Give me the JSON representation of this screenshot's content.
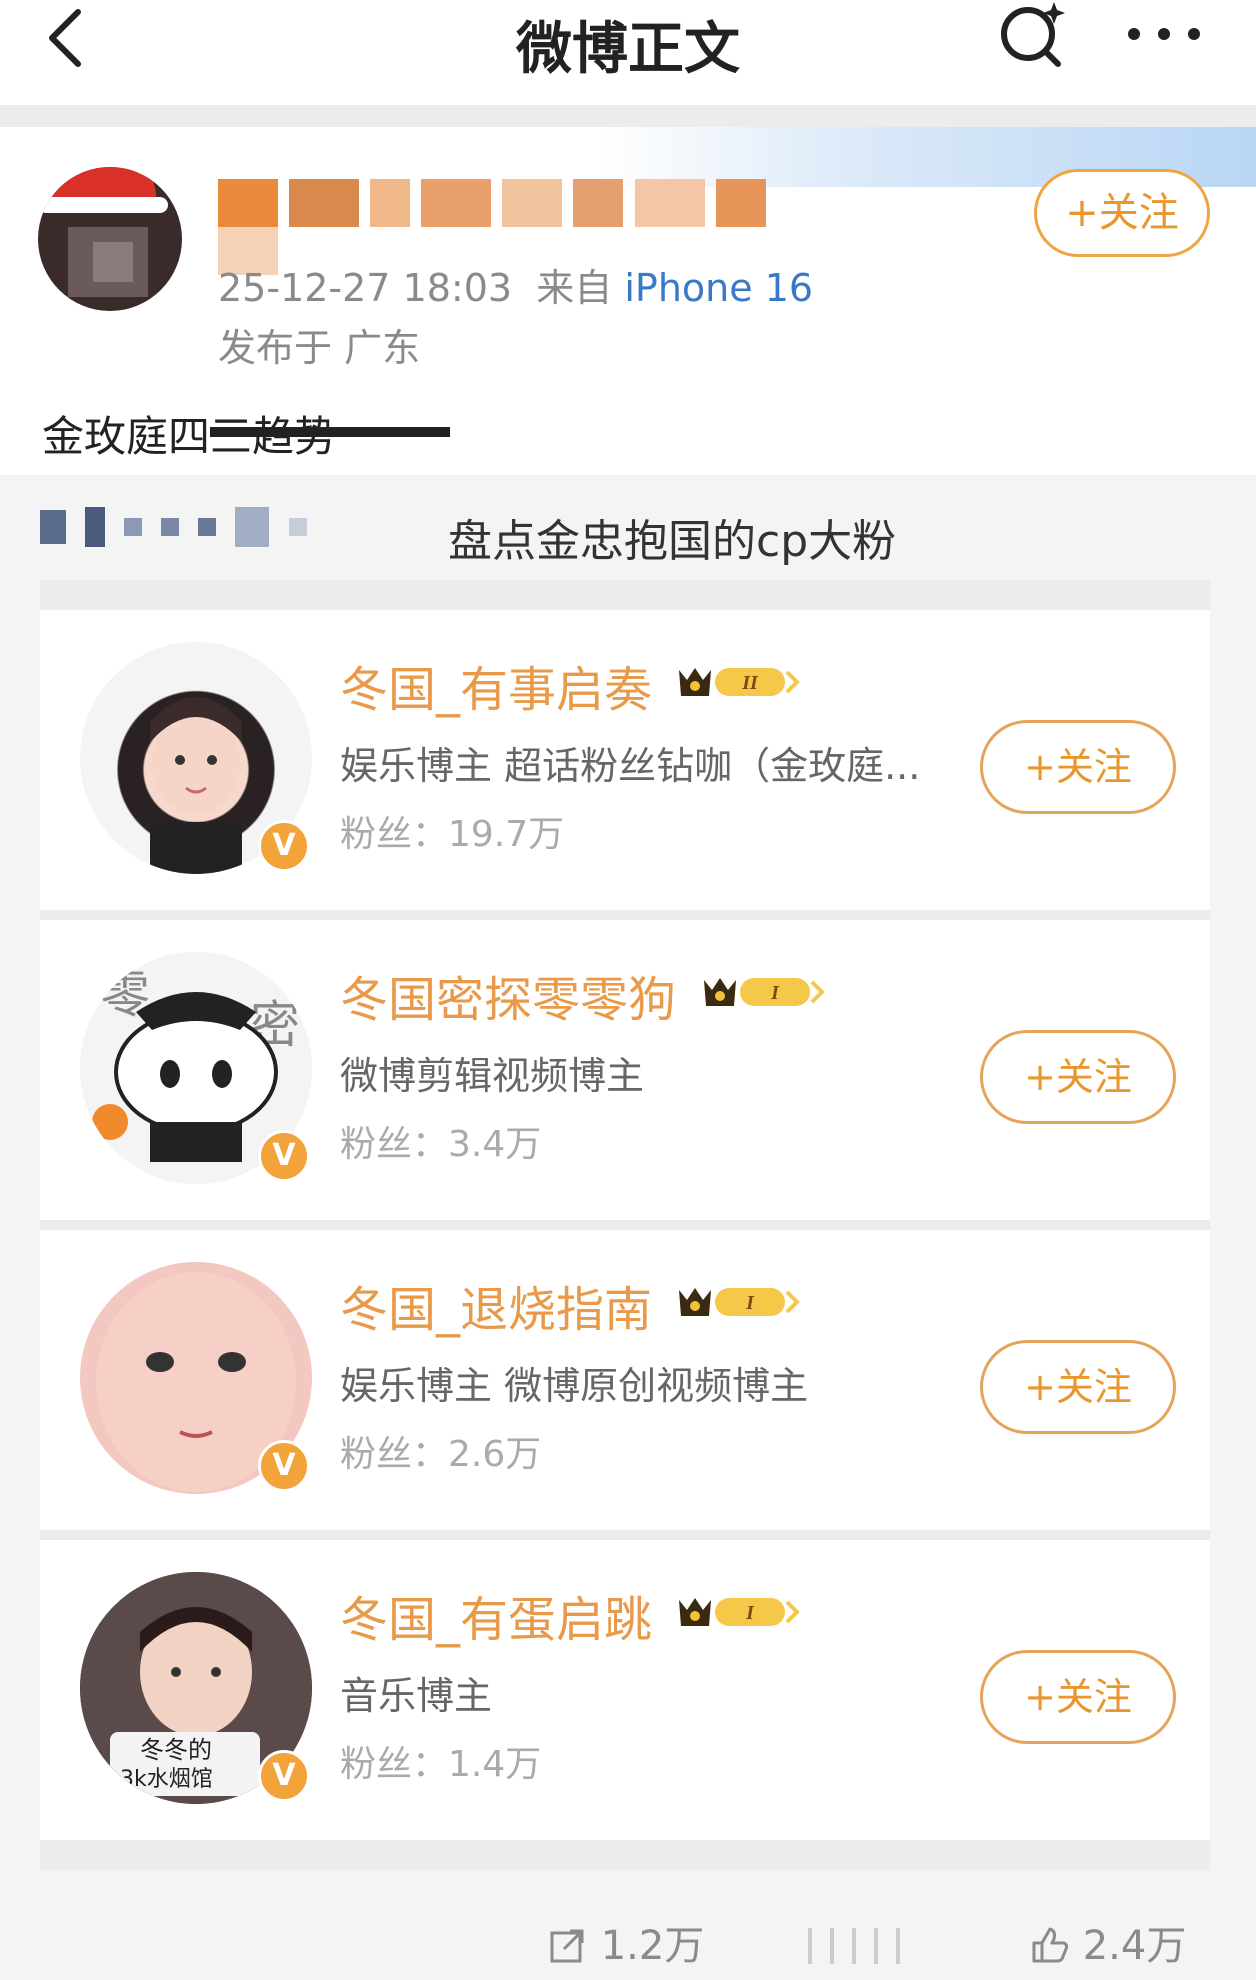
{
  "header": {
    "title": "微博正文",
    "back_icon": "chevron-left-icon",
    "search_icon": "search-sparkle-icon",
    "more_icon": "more-dots-icon"
  },
  "post": {
    "author_name_obscured": true,
    "time": "25-12-27 18:03",
    "from_label": "来自",
    "device": "iPhone 16",
    "location": "发布于 广东",
    "follow_label": "+关注",
    "text": "金玫庭四三趋势"
  },
  "repost": {
    "title": "盘点金忠抱国的cp大粉",
    "cards": [
      {
        "name": "冬国_有事启奏",
        "level": "II",
        "desc": "娱乐博主 超话粉丝钻咖（金玫庭...",
        "fans": "粉丝：19.7万",
        "follow_label": "+关注",
        "verified_label": "V"
      },
      {
        "name": "冬国密探零零狗",
        "level": "I",
        "desc": "微博剪辑视频博主",
        "fans": "粉丝：3.4万",
        "follow_label": "+关注",
        "verified_label": "V"
      },
      {
        "name": "冬国_退烧指南",
        "level": "I",
        "desc": "娱乐博主 微博原创视频博主",
        "fans": "粉丝：2.6万",
        "follow_label": "+关注",
        "verified_label": "V"
      },
      {
        "name": "冬国_有蛋启跳",
        "level": "I",
        "desc": "音乐博主",
        "fans": "粉丝：1.4万",
        "follow_label": "+关注",
        "verified_label": "V",
        "avatar_caption_1": "冬冬的",
        "avatar_caption_2": "3k水烟馆"
      }
    ]
  },
  "footer": {
    "share_count": "1.2万",
    "like_count": "2.4万"
  },
  "colors": {
    "accent_orange": "#e8962e",
    "name_orange": "#e89a4a",
    "device_blue": "#3a78c8"
  }
}
